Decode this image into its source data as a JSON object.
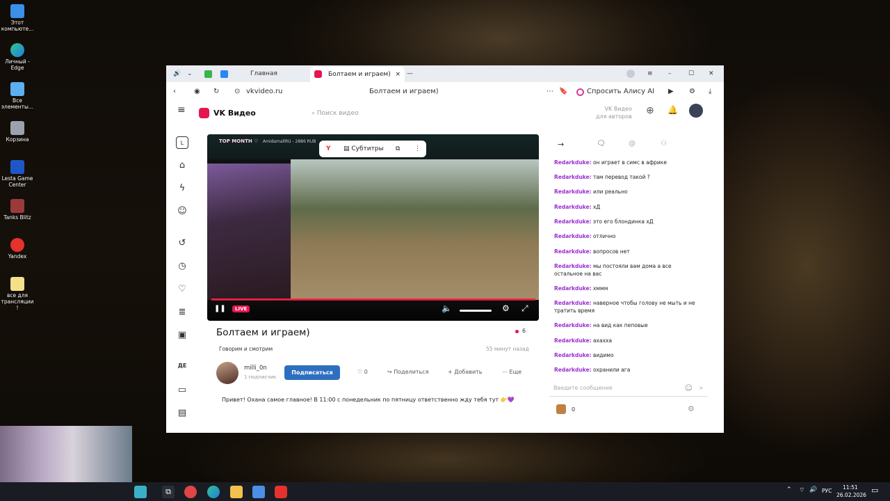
{
  "desktop": {
    "icons": [
      "Этот компьюте...",
      "Личный - Edge",
      "Все элементы...",
      "Корзина",
      "Lesta Game Center",
      "Tanks Blitz",
      "Yandex",
      "все для трансляции !"
    ]
  },
  "browser": {
    "tab_home": "Главная",
    "tab_active": "Болтаем и играем)",
    "address": "vkvideo.ru",
    "page_title": "Болтаем и играем)",
    "alice": "Спросить Алису AI"
  },
  "site": {
    "logo": "VK Видео",
    "search_placeholder": "Поиск видео",
    "authors_line1": "VK Видео",
    "authors_line2": "для авторов"
  },
  "player": {
    "overlay_top": "TOP MONTH ♡",
    "overlay_user": "AmidamallRU - 2886 RUB",
    "subtitles": "Субтитры",
    "live": "LIVE"
  },
  "video": {
    "title": "Болтаем и играем)",
    "viewers": "6",
    "category": "Говорим и смотрим",
    "time_ago": "55 минут назад",
    "channel": "milli_0n",
    "subscribers": "1 подписчик",
    "subscribe": "Подписаться",
    "likes": "0",
    "share": "Поделиться",
    "add": "Добавить",
    "more": "Еще",
    "description": "Привет! Охана самое главное! В 11:00 с понедельник по пятницу ответственно жду тебя тут 👉💜"
  },
  "chat": {
    "messages": [
      {
        "user": "Redarkduke:",
        "text": "он играет в симс в африке"
      },
      {
        "user": "Redarkduke:",
        "text": "там перевод такой ?"
      },
      {
        "user": "Redarkduke:",
        "text": "или реально"
      },
      {
        "user": "Redarkduke:",
        "text": "хД"
      },
      {
        "user": "Redarkduke:",
        "text": "это его блондинка хД"
      },
      {
        "user": "Redarkduke:",
        "text": "отлично"
      },
      {
        "user": "Redarkduke:",
        "text": "вопросов нет"
      },
      {
        "user": "Redarkduke:",
        "text": "мы постояли вам дома а все остальное на вас"
      },
      {
        "user": "Redarkduke:",
        "text": "хммм"
      },
      {
        "user": "Redarkduke:",
        "text": "наверное чтобы голову не мыть и не тратить время"
      },
      {
        "user": "Redarkduke:",
        "text": "на вид как пеповые"
      },
      {
        "user": "Redarkduke:",
        "text": "ахахха"
      },
      {
        "user": "Redarkduke:",
        "text": "видимо"
      },
      {
        "user": "Redarkduke:",
        "text": "охранили ага"
      }
    ],
    "input_placeholder": "Введите сообщение",
    "counter": "0"
  },
  "taskbar": {
    "lang": "РУС",
    "time": "11:51",
    "date": "26.02.2026"
  }
}
